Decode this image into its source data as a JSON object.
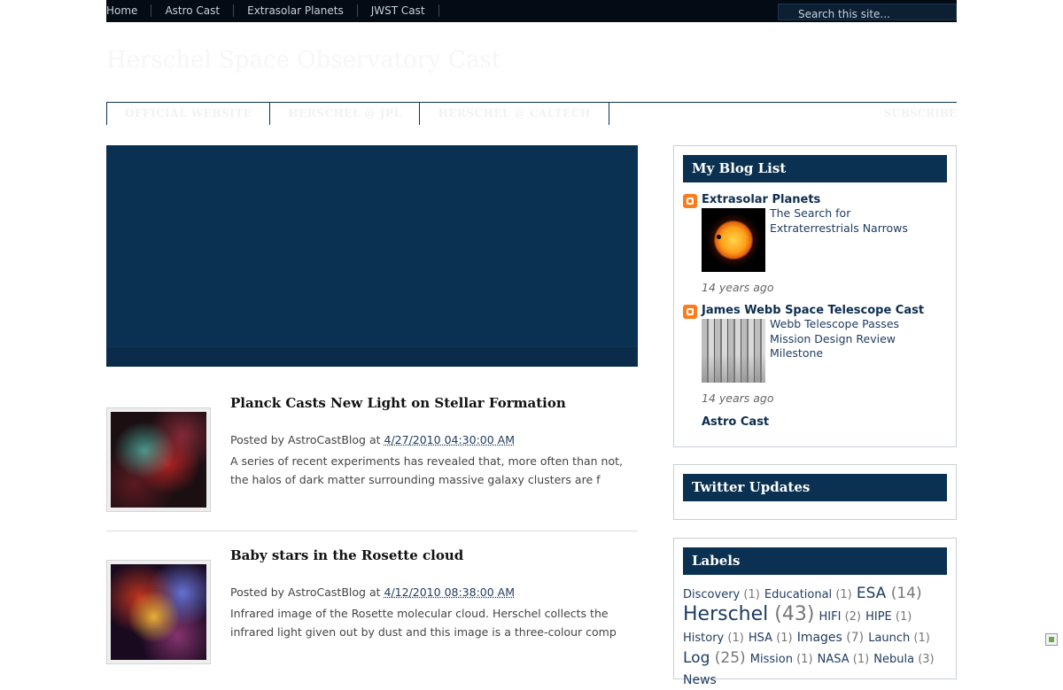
{
  "topnav": {
    "links": [
      "Home",
      "Astro Cast",
      "Extrasolar Planets",
      "JWST Cast"
    ],
    "search_placeholder": "Search this site..."
  },
  "header": {
    "title": "Herschel Space Observatory Cast",
    "nav": [
      "OFFICIAL WEBSITE",
      "HERSCHEL @ JPL",
      "HERSCHEL @ CALTECH"
    ],
    "subscribe": "SUBSCRIBE"
  },
  "posts": [
    {
      "title": "Planck Casts New Light on Stellar Formation",
      "posted_by": "Posted by AstroCastBlog at",
      "date": "4/27/2010 04:30:00 AM",
      "excerpt": "A series of recent experiments has revealed that, more often than not, the halos of dark matter surrounding massive galaxy clusters are f"
    },
    {
      "title": "Baby stars in the Rosette cloud",
      "posted_by": "Posted by AstroCastBlog at",
      "date": "4/12/2010 08:38:00 AM",
      "excerpt": "Infrared image of the Rosette molecular cloud. Herschel collects the infrared light given out by dust and this image is a three-colour comp"
    }
  ],
  "sidebar": {
    "blog_list": {
      "heading": "My Blog List",
      "entries": [
        {
          "name": "Extrasolar Planets",
          "post_title": "The Search for Extraterrestrials Narrows",
          "ago": "14 years ago"
        },
        {
          "name": "James Webb Space Telescope Cast",
          "post_title": "Webb Telescope Passes Mission Design Review Milestone",
          "ago": "14 years ago"
        }
      ],
      "extra": "Astro Cast"
    },
    "twitter": {
      "heading": "Twitter Updates"
    },
    "labels": {
      "heading": "Labels",
      "items": [
        {
          "name": "Discovery",
          "count": "(1)",
          "size": 13
        },
        {
          "name": "Educational",
          "count": "(1)",
          "size": 13
        },
        {
          "name": "ESA",
          "count": "(14)",
          "size": 17
        },
        {
          "name": "Herschel",
          "count": "(43)",
          "size": 22
        },
        {
          "name": "HIFI",
          "count": "(2)",
          "size": 13
        },
        {
          "name": "HIPE",
          "count": "(1)",
          "size": 13
        },
        {
          "name": "History",
          "count": "(1)",
          "size": 13
        },
        {
          "name": "HSA",
          "count": "(1)",
          "size": 13
        },
        {
          "name": "Images",
          "count": "(7)",
          "size": 14
        },
        {
          "name": "Launch",
          "count": "(1)",
          "size": 13
        },
        {
          "name": "Log",
          "count": "(25)",
          "size": 17
        },
        {
          "name": "Mission",
          "count": "(1)",
          "size": 13
        },
        {
          "name": "NASA",
          "count": "(1)",
          "size": 13
        },
        {
          "name": "Nebula",
          "count": "(3)",
          "size": 13
        },
        {
          "name": "News",
          "count": "",
          "size": 14
        }
      ]
    }
  }
}
